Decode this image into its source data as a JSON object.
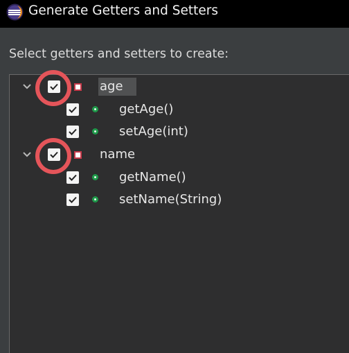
{
  "window": {
    "title": "Generate Getters and Setters",
    "accent_color": "#e5555a"
  },
  "prompt": {
    "text": "Select getters and setters to create:"
  },
  "tree": {
    "nodes": [
      {
        "label": "age",
        "icon": "private-field-icon",
        "checked": true,
        "expanded": true,
        "selected": true,
        "children": [
          {
            "label": "getAge()",
            "icon": "public-method-icon",
            "checked": true
          },
          {
            "label": "setAge(int)",
            "icon": "public-method-icon",
            "checked": true
          }
        ]
      },
      {
        "label": "name",
        "icon": "private-field-icon",
        "checked": true,
        "expanded": true,
        "selected": false,
        "children": [
          {
            "label": "getName()",
            "icon": "public-method-icon",
            "checked": true
          },
          {
            "label": "setName(String)",
            "icon": "public-method-icon",
            "checked": true
          }
        ]
      }
    ]
  }
}
